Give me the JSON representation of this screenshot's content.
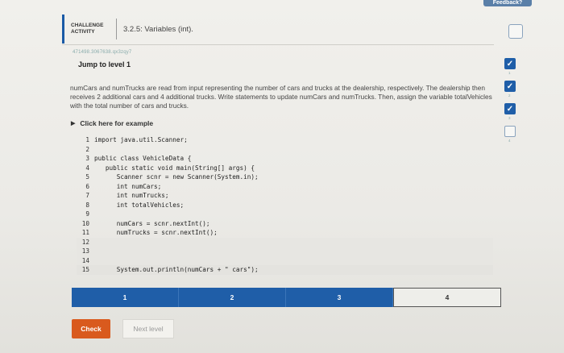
{
  "feedback_label": "Feedback?",
  "header": {
    "activity_label": "CHALLENGE ACTIVITY",
    "title": "3.2.5: Variables (int)."
  },
  "activity_id": "471498.3067638.qx3zqy7",
  "jump_label": "Jump to level 1",
  "description": "numCars and numTrucks are read from input representing the number of cars and trucks at the dealership, respectively. The dealership then receives 2 additional cars and 4 additional trucks. Write statements to update numCars and numTrucks. Then, assign the variable totalVehicles with the total number of cars and trucks.",
  "click_example": "Click here for example",
  "code_lines": [
    {
      "num": "1",
      "text": "import java.util.Scanner;"
    },
    {
      "num": "2",
      "text": ""
    },
    {
      "num": "3",
      "text": "public class VehicleData {"
    },
    {
      "num": "4",
      "text": "   public static void main(String[] args) {"
    },
    {
      "num": "5",
      "text": "      Scanner scnr = new Scanner(System.in);"
    },
    {
      "num": "6",
      "text": "      int numCars;"
    },
    {
      "num": "7",
      "text": "      int numTrucks;"
    },
    {
      "num": "8",
      "text": "      int totalVehicles;"
    },
    {
      "num": "9",
      "text": ""
    },
    {
      "num": "10",
      "text": "      numCars = scnr.nextInt();"
    },
    {
      "num": "11",
      "text": "      numTrucks = scnr.nextInt();"
    },
    {
      "num": "12",
      "text": ""
    },
    {
      "num": "13",
      "text": ""
    },
    {
      "num": "14",
      "text": ""
    },
    {
      "num": "15",
      "text": "      System.out.println(numCars + \" cars\");"
    }
  ],
  "levels": [
    "1",
    "2",
    "3",
    "4"
  ],
  "current_level": "4",
  "check_label": "Check",
  "next_label": "Next level",
  "side_progress": [
    {
      "label": "1",
      "state": "done"
    },
    {
      "label": "2",
      "state": "done"
    },
    {
      "label": "3",
      "state": "done"
    },
    {
      "label": "4",
      "state": "todo"
    }
  ],
  "colors": {
    "accent": "#1f5ea8",
    "check": "#d95a1e"
  }
}
